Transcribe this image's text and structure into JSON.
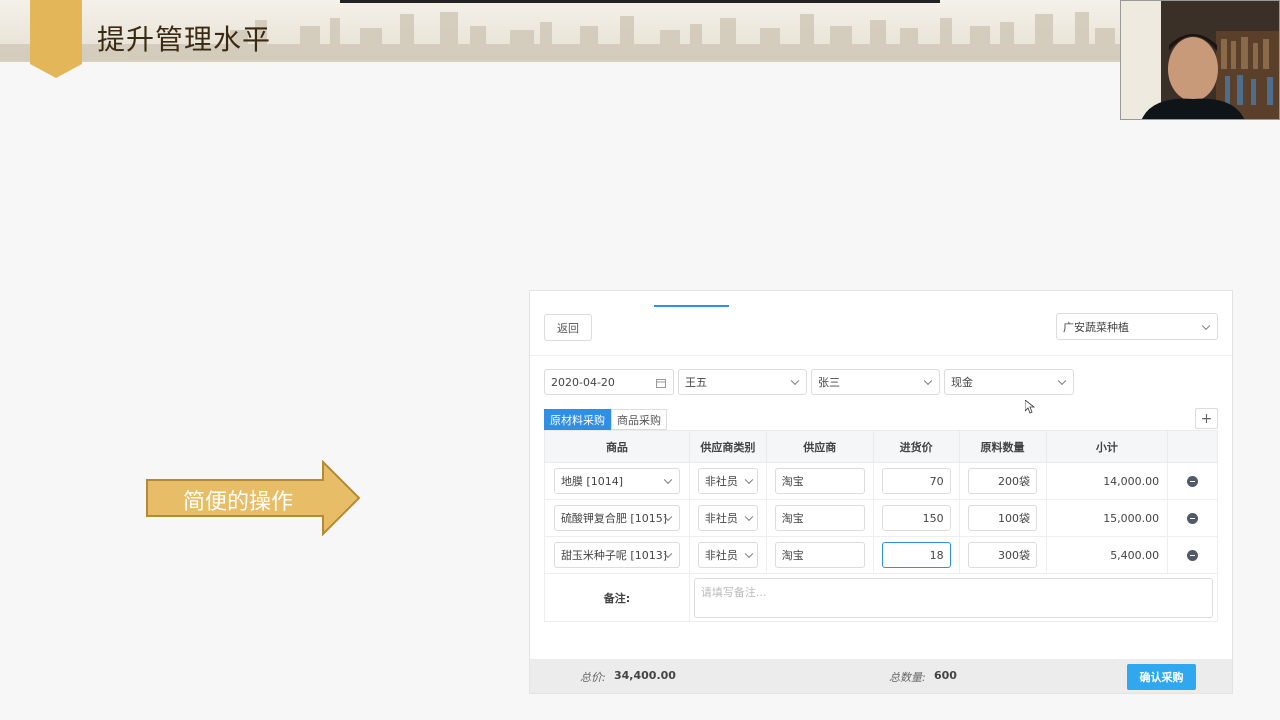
{
  "slide": {
    "title": "提升管理水平",
    "arrow_label": "简便的操作",
    "colors": {
      "accent": "#e3b659",
      "arrow": "#e7bd68",
      "primary": "#2f8fe5"
    }
  },
  "toolbar": {
    "back_label": "返回",
    "farm_select": "广安蔬菜种植"
  },
  "filters": {
    "date": "2020-04-20",
    "person1": "王五",
    "person2": "张三",
    "payment": "现金"
  },
  "tabs": [
    {
      "label": "原材料采购",
      "active": true
    },
    {
      "label": "商品采购",
      "active": false
    }
  ],
  "add_label": "+",
  "table": {
    "headers": [
      "商品",
      "供应商类别",
      "供应商",
      "进货价",
      "原料数量",
      "小计"
    ],
    "rows": [
      {
        "product": "地膜 [1014]",
        "supplier_type": "非社员",
        "supplier": "淘宝",
        "price": "70",
        "qty": "200袋",
        "subtotal": "14,000.00"
      },
      {
        "product": "硫酸钾复合肥 [1015]",
        "supplier_type": "非社员",
        "supplier": "淘宝",
        "price": "150",
        "qty": "100袋",
        "subtotal": "15,000.00"
      },
      {
        "product": "甜玉米种子呢 [1013]",
        "supplier_type": "非社员",
        "supplier": "淘宝",
        "price": "18",
        "qty": "300袋",
        "subtotal": "5,400.00"
      }
    ],
    "note_label": "备注:",
    "note_placeholder": "请填写备注..."
  },
  "footer": {
    "total_price_label": "总价:",
    "total_price": "34,400.00",
    "total_qty_label": "总数量:",
    "total_qty": "600",
    "confirm_label": "确认采购"
  }
}
